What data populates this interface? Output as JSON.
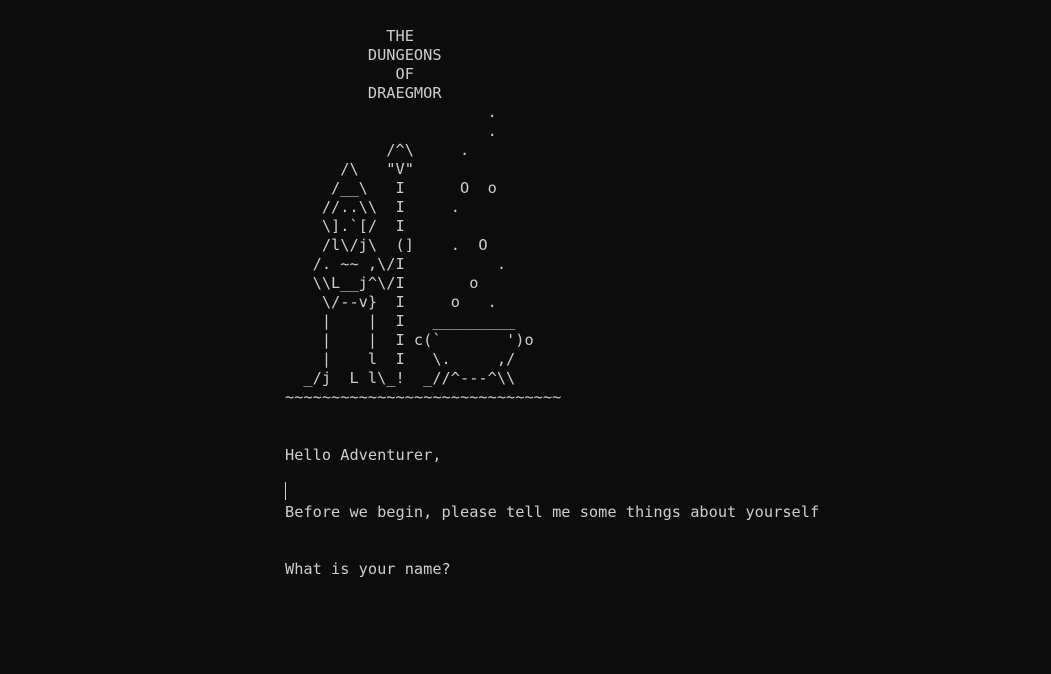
{
  "terminal": {
    "background": "#0c0c0c",
    "foreground": "#cccccc",
    "ascii_art": "           THE\n         DUNGEONS\n            OF\n         DRAEGMOR\n                      .\n                      .\n           /^\\     .\n      /\\   \"V\"\n     /__\\   I      O  o\n    //..\\\\  I     .\n    \\].`[/  I\n    /l\\/j\\  (]    .  O\n   /. ~~ ,\\/I          .\n   \\\\L__j^\\/I       o\n    \\/--v}  I     o   .\n    |    |  I   _________\n    |    |  I c(`       ')o\n    |    l  I   \\.     ,/\n  _/j  L l\\_!  _//^---^\\\\\n~~~~~~~~~~~~~~~~~~~~~~~~~~~~~~",
    "greeting": "Hello Adventurer,",
    "intro": "Before we begin, please tell me some things about yourself",
    "question": "What is your name?",
    "input_value": ""
  }
}
